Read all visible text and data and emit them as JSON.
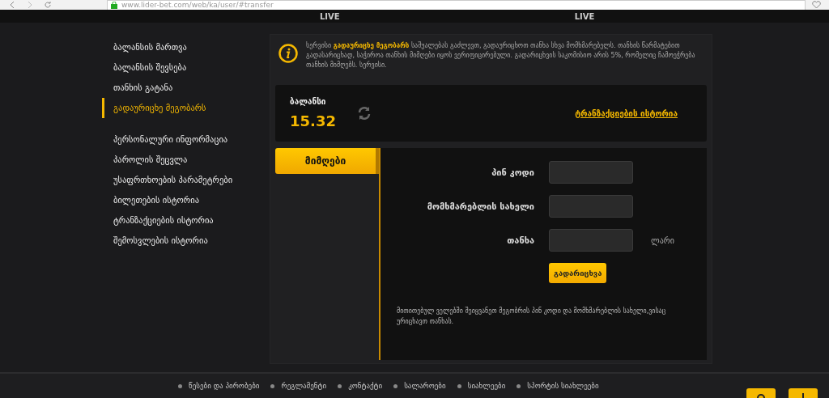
{
  "browser": {
    "url": "www.lider-bet.com/web/ka/user/#transfer"
  },
  "nav": {
    "items": [
      {
        "label": "LIVE"
      },
      {
        "label": "LIVE"
      }
    ]
  },
  "sidebar": {
    "groups": [
      [
        {
          "label": "ბალანსის მართვა",
          "selected": false
        },
        {
          "label": "ბალანსის შევსება",
          "selected": false
        },
        {
          "label": "თანხის გატანა",
          "selected": false
        },
        {
          "label": "გადაურიცხე მეგობარს",
          "selected": true
        }
      ],
      [
        {
          "label": "პერსონალური ინფორმაცია",
          "selected": false
        },
        {
          "label": "პაროლის შეცვლა",
          "selected": false
        },
        {
          "label": "უსაფრთხოების პარამეტრები",
          "selected": false
        },
        {
          "label": "ბილეთების ისტორია",
          "selected": false
        },
        {
          "label": "ტრანზაქციების ისტორია",
          "selected": false
        },
        {
          "label": "შემოსვლების ისტორია",
          "selected": false
        }
      ]
    ]
  },
  "info": {
    "text": "სერვისი **გადაურიცხე მეგობარს** საშუალებას გაძლევთ, გადაურიცხოთ თანხა სხვა მომხმარებელს. თანხის წარმატებით გადასარიცხად, საჭიროა თანხის მიმღები იყოს ვერიფიცირებული. გადარიცხვის საკომისიო არის 5%, რომელიც ჩამოეჭრება თანხის მიმღებს. სერვისი."
  },
  "balance": {
    "label": "ბალანსი",
    "amount": "15.32",
    "history_link": "ტრანზაქციების ისტორია"
  },
  "tab": {
    "label": "მიმღები"
  },
  "form": {
    "fields": [
      {
        "label": "პინ კოდი"
      },
      {
        "label": "მომხმარებლის სახელი"
      },
      {
        "label": "თანხა",
        "unit": "ლარი"
      }
    ],
    "submit": "გადარიცხვა",
    "note": "მითითებულ ველებში შეიყვანეთ მეგობრის პინ კოდი და მომხმარებლის სახელი,ვისაც ურიცხავთ თანხას."
  },
  "footer": {
    "links": [
      "წესები და პირობები",
      "რეგლამენტი",
      "კონტაქტი",
      "სალაროები",
      "სიახლეები",
      "სპორტის სიახლეები"
    ]
  }
}
